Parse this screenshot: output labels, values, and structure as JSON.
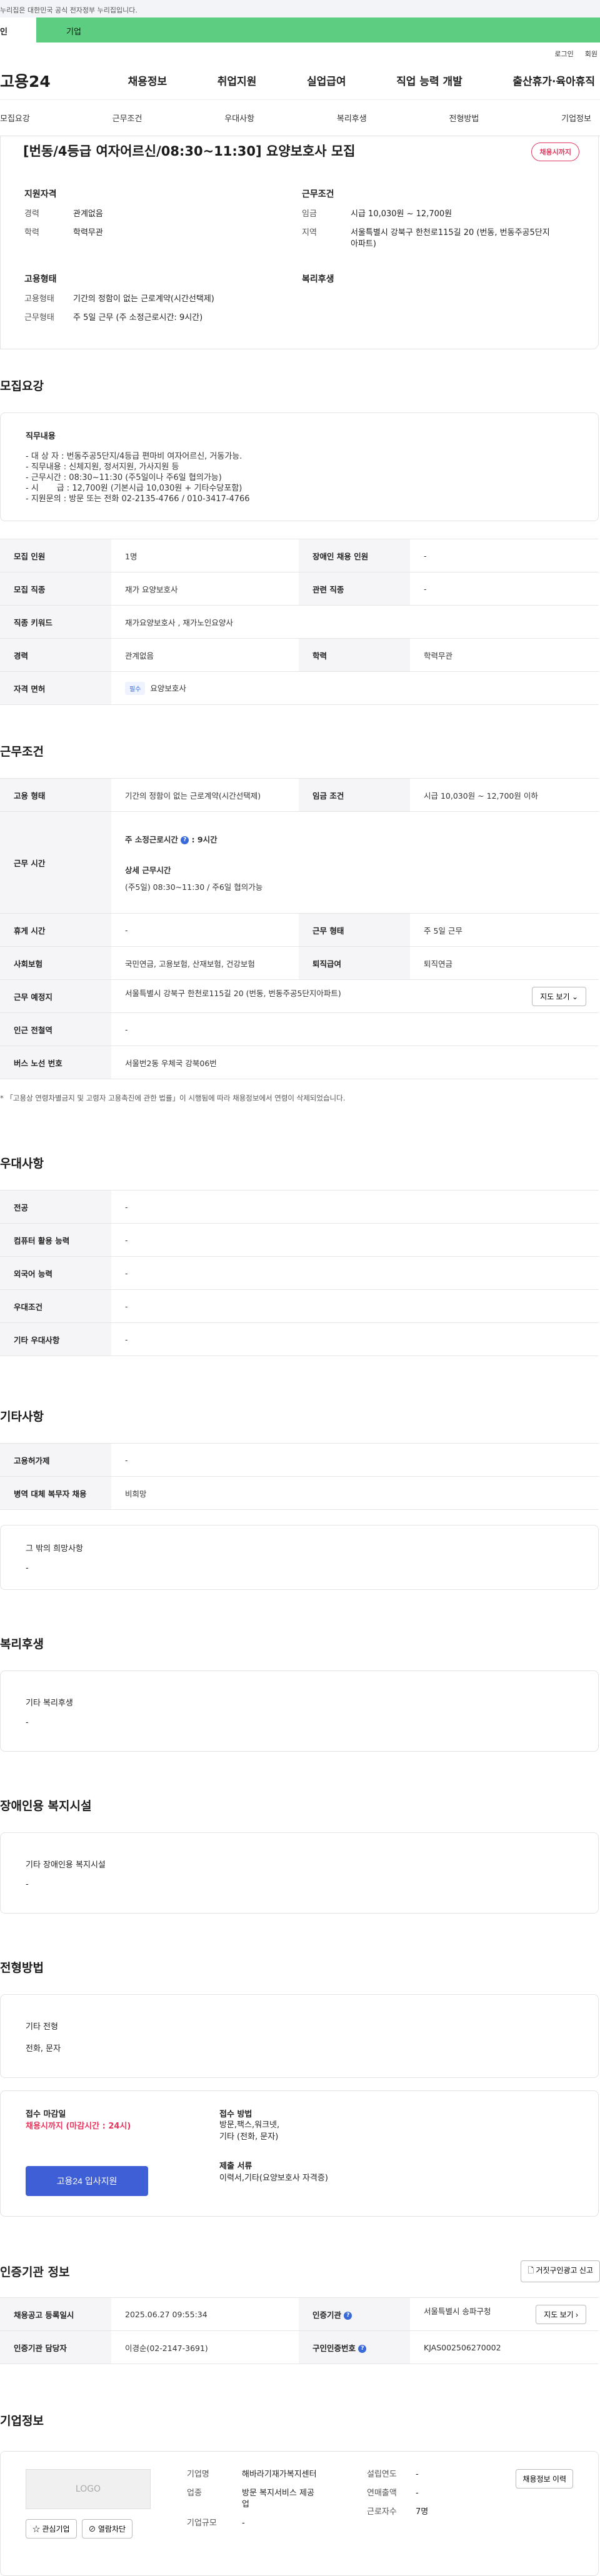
{
  "gov_bar": "누리집은 대한민국 공식 전자정부 누리집입니다.",
  "top_tabs": [
    "인",
    "기업"
  ],
  "util": [
    "로그인",
    "회원"
  ],
  "gnb": {
    "logo": "고용24",
    "menus": [
      "채용정보",
      "취업지원",
      "실업급여",
      "직업 능력 개발",
      "출산휴가·육아휴직"
    ]
  },
  "subnav": [
    "모집요강",
    "근무조건",
    "우대사항",
    "복리후생",
    "전형방법",
    "기업정보"
  ],
  "job": {
    "title": "[번동/4등급 여자어르신/08:30~11:30] 요양보호사 모집",
    "badge": "채용시까지",
    "qual_title": "지원자격",
    "qual": [
      {
        "k": "경력",
        "v": "관계없음"
      },
      {
        "k": "학력",
        "v": "학력무관"
      }
    ],
    "cond_title": "근무조건",
    "cond": [
      {
        "k": "임금",
        "v": "시급 10,030원 ~ 12,700원"
      },
      {
        "k": "지역",
        "v": "서울특별시 강북구 한천로115길 20 (번동, 번동주공5단지아파트)"
      }
    ],
    "emp_title": "고용형태",
    "emp": [
      {
        "k": "고용형태",
        "v": "기간의 정함이 없는 근로계약(시간선택제)"
      },
      {
        "k": "근무형태",
        "v": "주 5일 근무 (주 소정근로시간: 9시간)"
      }
    ],
    "welfare_title": "복리후생"
  },
  "recruit": {
    "title": "모집요강",
    "duty_label": "직무내용",
    "duty_text": "- 대 상 자 : 번동주공5단지/4등급 편마비 여자어르신, 거동가능.\n- 직무내용 : 신체지원, 정서지원, 가사지원 등\n- 근무시간 : 08:30~11:30 (주5일이나 주6일 협의가능)\n- 시       급 : 12,700원 (기본시급 10,030원 + 기타수당포함)\n- 지원문의 : 방문 또는 전화 02-2135-4766 / 010-3417-4766",
    "rows": [
      {
        "k1": "모집 인원",
        "v1": "1명",
        "k2": "장애인 채용 인원",
        "v2": "-"
      },
      {
        "k1": "모집 직종",
        "v1": "재가 요양보호사",
        "k2": "관련 직종",
        "v2": "-"
      },
      {
        "k1": "직종 키워드",
        "v1": "재가요양보호사 , 재가노인요양사"
      },
      {
        "k1": "경력",
        "v1": "관계없음",
        "k2": "학력",
        "v2": "학력무관"
      },
      {
        "k1": "자격 면허",
        "tag": "필수",
        "v1": "요양보호사"
      }
    ]
  },
  "work": {
    "title": "근무조건",
    "type_k": "고용 형태",
    "type_v": "기간의 정함이 없는 근로계약(시간선택제)",
    "wage_k": "임금 조건",
    "wage_v": "시급 10,030원 ~ 12,700원 이하",
    "hours_k": "근무 시간",
    "hours_main": "주 소정근로시간",
    "hours_val": ": 9시간",
    "hours_detail_label": "상세 근무시간",
    "hours_detail": "(주5일) 08:30~11:30 / 주6일 협의가능",
    "rest_k": "휴게 시간",
    "rest_v": "-",
    "form_k": "근무 형태",
    "form_v": "주 5일 근무",
    "ins_k": "사회보험",
    "ins_v": "국민연금, 고용보험, 산재보험, 건강보험",
    "ret_k": "퇴직급여",
    "ret_v": "퇴직연금",
    "place_k": "근무 예정지",
    "place_v": "서울특별시 강북구 한천로115길 20 (번동, 번동주공5단지아파트)",
    "map_btn": "지도 보기",
    "station_k": "인근 전철역",
    "station_v": "-",
    "bus_k": "버스 노선 번호",
    "bus_v": "서울번2동 우체국 강북06번",
    "note": "* 「고용상 연령차별금지 및 고령자 고용촉진에 관한 법률」이 시행됨에 따라 채용정보에서 연령이 삭제되었습니다."
  },
  "pref": {
    "title": "우대사항",
    "rows": [
      {
        "k": "전공",
        "v": "-"
      },
      {
        "k": "컴퓨터 활용 능력",
        "v": "-"
      },
      {
        "k": "외국어 능력",
        "v": "-"
      },
      {
        "k": "우대조건",
        "v": "-"
      },
      {
        "k": "기타 우대사항",
        "v": "-"
      }
    ]
  },
  "etc": {
    "title": "기타사항",
    "rows": [
      {
        "k": "고용허가제",
        "v": "-"
      },
      {
        "k": "병역 대체 복무자 채용",
        "v": "비희망"
      }
    ],
    "hope_label": "그 밖의 희망사항",
    "hope_v": "-"
  },
  "welfare": {
    "title": "복리후생",
    "label": "기타 복리후생",
    "v": "-"
  },
  "disabled": {
    "title": "장애인용 복지시설",
    "label": "기타 장애인용 복지시설",
    "v": "-"
  },
  "process": {
    "title": "전형방법",
    "label": "기타 전형",
    "v": "전화, 문자",
    "deadline_label": "접수 마감일",
    "deadline_v": "채용시까지 (마감시간 : 24시)",
    "apply_btn": "고용24 입사지원",
    "method_label": "접수 방법",
    "method_v1": "방문,팩스,워크넷,",
    "method_v2": "기타 (전화, 문자)",
    "docs_label": "제출 서류",
    "docs_v": "이력서,기타(요양보호사 자격증)"
  },
  "cert": {
    "title": "인증기관 정보",
    "report_btn": "거짓구인광고 신고",
    "reg_k": "채용공고 등록일시",
    "reg_v": "2025.06.27 09:55:34",
    "org_k": "인증기관",
    "org_v": "서울특별시 송파구청",
    "map_btn": "지도 보기",
    "mgr_k": "인증기관 담당자",
    "mgr_v": "이경순(02-2147-3691)",
    "num_k": "구인인증번호",
    "num_v": "KJAS002506270002"
  },
  "company": {
    "title": "기업정보",
    "logo": "LOGO",
    "interest_btn": "관심기업",
    "block_btn": "열람차단",
    "name_k": "기업명",
    "name_v": "해바라기재가복지센터",
    "ind_k": "업종",
    "ind_v": "방문 복지서비스 제공업",
    "scale_k": "기업규모",
    "scale_v": "-",
    "est_k": "설립연도",
    "est_v": "-",
    "sales_k": "연매출액",
    "sales_v": "-",
    "emp_k": "근로자수",
    "emp_v": "7명",
    "history_btn": "채용정보 이력"
  },
  "colors": {
    "accent_green": "#5dce81",
    "accent_blue": "#3f5fd6",
    "badge_red": "#e5355e"
  }
}
